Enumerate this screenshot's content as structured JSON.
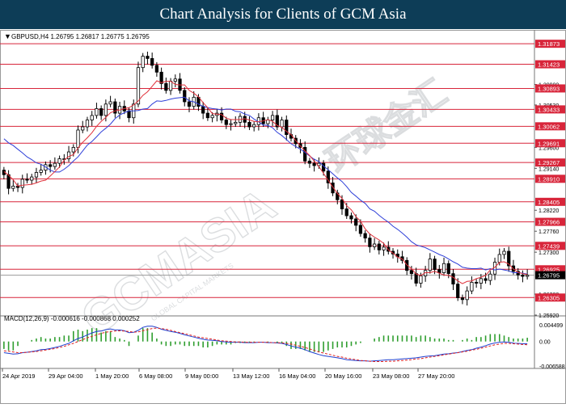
{
  "header": {
    "title": "Chart Analysis for Clients of GCM Asia"
  },
  "watermark": {
    "brand": "GCMASIA",
    "sub": "GLOBAL CAPITAL MARKETS",
    "cn": "环球金汇"
  },
  "chart_data": [
    {
      "type": "candlestick",
      "info": "GBPUSD,H4  1.26795 1.26817 1.26775 1.26795",
      "ylim": [
        1.2592,
        1.32
      ],
      "grid": false,
      "price_ticks": [
        "1.30980",
        "1.30530",
        "1.29600",
        "1.29140",
        "1.28220",
        "1.27760",
        "1.27300",
        "1.26380",
        "1.25920"
      ],
      "levels": [
        {
          "value": 1.31873,
          "label": "1.31873"
        },
        {
          "value": 1.31423,
          "label": "1.31423"
        },
        {
          "value": 1.30893,
          "label": "1.30893"
        },
        {
          "value": 1.30433,
          "label": "1.30433"
        },
        {
          "value": 1.30062,
          "label": "1.30062"
        },
        {
          "value": 1.29691,
          "label": "1.29691"
        },
        {
          "value": 1.29267,
          "label": "1.29267"
        },
        {
          "value": 1.2891,
          "label": "1.28910"
        },
        {
          "value": 1.28405,
          "label": "1.28405"
        },
        {
          "value": 1.27966,
          "label": "1.27966"
        },
        {
          "value": 1.27439,
          "label": "1.27439"
        },
        {
          "value": 1.26925,
          "label": "1.26925"
        },
        {
          "value": 1.26305,
          "label": "1.26305"
        }
      ],
      "current": {
        "value": 1.26795,
        "label": "1.26795"
      },
      "x_labels": [
        "24 Apr 2019",
        "29 Apr 04:00",
        "1 May 20:00",
        "6 May 08:00",
        "9 May 00:00",
        "13 May 12:00",
        "16 May 04:00",
        "20 May 16:00",
        "23 May 08:00",
        "27 May 20:00"
      ],
      "close": [
        1.29,
        1.287,
        1.2875,
        1.2872,
        1.289,
        1.2888,
        1.2895,
        1.2905,
        1.291,
        1.2922,
        1.2918,
        1.2925,
        1.2935,
        1.2935,
        1.295,
        1.296,
        1.2998,
        1.3005,
        1.302,
        1.303,
        1.3045,
        1.303,
        1.3055,
        1.306,
        1.3035,
        1.305,
        1.304,
        1.3025,
        1.3055,
        1.3135,
        1.316,
        1.3155,
        1.314,
        1.3125,
        1.31,
        1.3085,
        1.3105,
        1.311,
        1.3085,
        1.306,
        1.305,
        1.307,
        1.305,
        1.3035,
        1.3025,
        1.303,
        1.3035,
        1.302,
        1.301,
        1.3012,
        1.3015,
        1.3028,
        1.3015,
        1.3005,
        1.301,
        1.3025,
        1.3012,
        1.302,
        1.303,
        1.3005,
        1.302,
        1.2988,
        1.298,
        1.2968,
        1.296,
        1.293,
        1.2925,
        1.292,
        1.2925,
        1.2908,
        1.2882,
        1.286,
        1.2845,
        1.2825,
        1.281,
        1.2803,
        1.2789,
        1.2771,
        1.2761,
        1.2742,
        1.2748,
        1.2735,
        1.2741,
        1.2732,
        1.2726,
        1.272,
        1.2712,
        1.269,
        1.2683,
        1.2662,
        1.2678,
        1.269,
        1.2715,
        1.2692,
        1.2685,
        1.2705,
        1.2683,
        1.266,
        1.263,
        1.2626,
        1.2645,
        1.2664,
        1.2662,
        1.2672,
        1.2668,
        1.2682,
        1.2708,
        1.2725,
        1.2732,
        1.27,
        1.2688,
        1.268,
        1.2677,
        1.26795
      ],
      "sma_fast": [
        1.2907,
        1.2899,
        1.2889,
        1.2875,
        1.2877,
        1.2878,
        1.2879,
        1.2882,
        1.2886,
        1.2888,
        1.2897,
        1.2907,
        1.2917,
        1.2932,
        1.294,
        1.2944,
        1.2959,
        1.2971,
        1.2981,
        1.2992,
        1.3006,
        1.3017,
        1.3026,
        1.3036,
        1.304,
        1.3042,
        1.3045,
        1.3047,
        1.3053,
        1.3062,
        1.3074,
        1.3082,
        1.3094,
        1.3106,
        1.3102,
        1.3105,
        1.3105,
        1.3098,
        1.3097,
        1.3097,
        1.3085,
        1.3079,
        1.3071,
        1.3058,
        1.3047,
        1.3034,
        1.3033,
        1.3032,
        1.3024,
        1.3021,
        1.3021,
        1.3021,
        1.3023,
        1.302,
        1.3017,
        1.3016,
        1.3018,
        1.3021,
        1.3017,
        1.3008,
        1.3004,
        1.2995,
        1.2988,
        1.2975,
        1.2963,
        1.2952,
        1.2942,
        1.293,
        1.2918,
        1.2903,
        1.2888,
        1.2873,
        1.2859,
        1.2848,
        1.2832,
        1.2823,
        1.2808,
        1.2798,
        1.2781,
        1.277,
        1.2763,
        1.2757,
        1.2749,
        1.2735,
        1.2728,
        1.2719,
        1.2715,
        1.2702,
        1.2694,
        1.2682,
        1.2679,
        1.2685,
        1.2685,
        1.2688,
        1.2684,
        1.268,
        1.2679,
        1.2675,
        1.2667,
        1.2661,
        1.2666,
        1.2667,
        1.2672,
        1.2675,
        1.2679,
        1.2691,
        1.2697,
        1.2708,
        1.2709,
        1.2704,
        1.2693,
        1.2686,
        1.2683,
        1.2681
      ],
      "sma_slow": [
        1.2979,
        1.297,
        1.2964,
        1.2956,
        1.2948,
        1.2939,
        1.2933,
        1.2926,
        1.2923,
        1.2917,
        1.291,
        1.2906,
        1.2906,
        1.2912,
        1.292,
        1.293,
        1.2939,
        1.2952,
        1.2965,
        1.2973,
        1.2983,
        1.2994,
        1.3002,
        1.3011,
        1.3023,
        1.3031,
        1.3036,
        1.304,
        1.304,
        1.3041,
        1.3044,
        1.3045,
        1.3055,
        1.3062,
        1.3061,
        1.3063,
        1.3066,
        1.3068,
        1.3069,
        1.307,
        1.3062,
        1.306,
        1.3055,
        1.305,
        1.3047,
        1.3045,
        1.3044,
        1.3042,
        1.3044,
        1.3044,
        1.3039,
        1.3038,
        1.3033,
        1.303,
        1.3022,
        1.3016,
        1.3009,
        1.3008,
        1.3003,
        1.2993,
        1.2986,
        1.2977,
        1.2968,
        1.2962,
        1.2956,
        1.2949,
        1.2941,
        1.2934,
        1.2929,
        1.2919,
        1.2911,
        1.2902,
        1.2893,
        1.2885,
        1.2874,
        1.2861,
        1.2853,
        1.2844,
        1.2837,
        1.2825,
        1.282,
        1.2811,
        1.2803,
        1.2796,
        1.2787,
        1.278,
        1.2772,
        1.2763,
        1.2753,
        1.2746,
        1.2743,
        1.274,
        1.2735,
        1.273,
        1.2725,
        1.2721,
        1.2715,
        1.2709,
        1.2704,
        1.2697,
        1.2695,
        1.2694,
        1.2694,
        1.2695,
        1.2691,
        1.2694,
        1.2691,
        1.2693,
        1.2691,
        1.2689,
        1.2685,
        1.2685,
        1.2684,
        1.2682
      ]
    },
    {
      "type": "macd",
      "label": "MACD(12,26,9) -0.000616 -0.000868 0.000252",
      "ylim": [
        -0.006588,
        0.004499
      ],
      "y_ticks": [
        "0.004499",
        "0.00",
        "-0.006588"
      ],
      "macd": [
        -0.003,
        -0.0032,
        -0.0034,
        -0.0033,
        -0.003,
        -0.0029,
        -0.0027,
        -0.0025,
        -0.0022,
        -0.0021,
        -0.0019,
        -0.0016,
        -0.0013,
        -0.0009,
        -0.0005,
        0.0002,
        0.0008,
        0.0012,
        0.0018,
        0.0023,
        0.0027,
        0.0028,
        0.0032,
        0.0034,
        0.0031,
        0.0031,
        0.0029,
        0.0024,
        0.0025,
        0.003,
        0.0038,
        0.0041,
        0.0041,
        0.0038,
        0.0033,
        0.003,
        0.0027,
        0.0025,
        0.0022,
        0.0018,
        0.0015,
        0.0012,
        0.0009,
        0.0006,
        0.0004,
        0.0003,
        0.0002,
        0.0,
        -0.0001,
        -0.0002,
        -0.0002,
        -0.0002,
        -0.0003,
        -0.0003,
        -0.0003,
        -0.0002,
        -0.0002,
        -0.0003,
        -0.0003,
        -0.0004,
        -0.0005,
        -0.0008,
        -0.0012,
        -0.0015,
        -0.0018,
        -0.0022,
        -0.0027,
        -0.0031,
        -0.0035,
        -0.0038,
        -0.004,
        -0.0042,
        -0.0044,
        -0.0046,
        -0.0049,
        -0.005,
        -0.0051,
        -0.0052,
        -0.0052,
        -0.0053,
        -0.0052,
        -0.0051,
        -0.005,
        -0.0049,
        -0.0049,
        -0.0048,
        -0.0047,
        -0.0046,
        -0.0045,
        -0.0044,
        -0.0042,
        -0.004,
        -0.0039,
        -0.0038,
        -0.0036,
        -0.0034,
        -0.0033,
        -0.0031,
        -0.003,
        -0.0027,
        -0.0024,
        -0.0022,
        -0.0018,
        -0.0015,
        -0.0011,
        -0.0007,
        -0.0004,
        -0.0002,
        -0.0001,
        -0.0002,
        -0.0004,
        -0.0005,
        -0.0006,
        -0.000616
      ],
      "signal": [
        -0.0025,
        -0.0026,
        -0.0028,
        -0.003,
        -0.003,
        -0.0029,
        -0.0028,
        -0.0027,
        -0.0025,
        -0.0023,
        -0.0021,
        -0.0019,
        -0.0016,
        -0.0013,
        -0.0009,
        -0.0005,
        0.0,
        0.0005,
        0.001,
        0.0014,
        0.0018,
        0.0022,
        0.0025,
        0.0027,
        0.0028,
        0.0029,
        0.0028,
        0.0027,
        0.0025,
        0.0026,
        0.0029,
        0.0032,
        0.0035,
        0.0036,
        0.0035,
        0.0033,
        0.003,
        0.0027,
        0.0024,
        0.0021,
        0.0018,
        0.0015,
        0.0012,
        0.001,
        0.0008,
        0.0006,
        0.0004,
        0.0002,
        0.0001,
        0.0,
        -0.0001,
        -0.0001,
        -0.0002,
        -0.0002,
        -0.0002,
        -0.0002,
        -0.0002,
        -0.0002,
        -0.0003,
        -0.0003,
        -0.0004,
        -0.0005,
        -0.0007,
        -0.001,
        -0.0013,
        -0.0016,
        -0.002,
        -0.0024,
        -0.0028,
        -0.0031,
        -0.0034,
        -0.0037,
        -0.004,
        -0.0042,
        -0.0045,
        -0.0047,
        -0.0049,
        -0.0051,
        -0.0052,
        -0.0053,
        -0.0054,
        -0.0054,
        -0.0054,
        -0.0053,
        -0.0053,
        -0.0052,
        -0.0051,
        -0.005,
        -0.0049,
        -0.0047,
        -0.0046,
        -0.0044,
        -0.0042,
        -0.004,
        -0.0038,
        -0.0036,
        -0.0034,
        -0.0032,
        -0.003,
        -0.0028,
        -0.0026,
        -0.0023,
        -0.0021,
        -0.0018,
        -0.0015,
        -0.0012,
        -0.0009,
        -0.0007,
        -0.0005,
        -0.0005,
        -0.0006,
        -0.0007,
        -0.0008,
        -0.000868
      ]
    }
  ],
  "colors": {
    "header_bg": "#0d3d57",
    "candle": "#000000",
    "level_line": "#d8253a",
    "level_label_bg": "#d8253a",
    "sma_fast": "#e0303a",
    "sma_slow": "#2e3fd8",
    "macd_line": "#1f3fcf",
    "signal_line": "#e02020",
    "histogram": "#2f9e2f"
  }
}
